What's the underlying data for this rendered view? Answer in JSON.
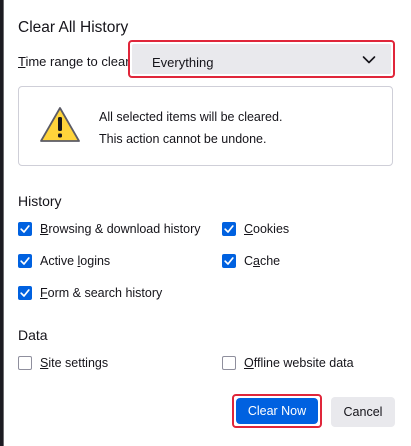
{
  "dialog": {
    "title": "Clear All History"
  },
  "time_range": {
    "label_prefix": "",
    "label_mnemonic": "T",
    "label_rest": "ime range to clear:",
    "selected": "Everything"
  },
  "warning": {
    "line1": "All selected items will be cleared.",
    "line2": "This action cannot be undone."
  },
  "history": {
    "title": "History",
    "browsing": {
      "m": "B",
      "rest": "rowsing & download history",
      "checked": true
    },
    "cookies": {
      "m": "C",
      "rest": "ookies",
      "checked": true
    },
    "logins": {
      "pre": "Active ",
      "m": "l",
      "rest": "ogins",
      "checked": true
    },
    "cache": {
      "pre": "C",
      "m": "a",
      "rest": "che",
      "checked": true
    },
    "forms": {
      "m": "F",
      "rest": "orm & search history",
      "checked": true
    }
  },
  "data": {
    "title": "Data",
    "site_settings": {
      "m": "S",
      "rest": "ite settings",
      "checked": false
    },
    "offline": {
      "m": "O",
      "rest": "ffline website data",
      "checked": false
    }
  },
  "buttons": {
    "clear_now": "Clear Now",
    "cancel": "Cancel"
  },
  "colors": {
    "accent": "#0061e0",
    "highlight": "#e0263a",
    "warning_yellow": "#ffd43b"
  },
  "icons": {
    "dropdown": "chevron-down-icon",
    "warning": "warning-triangle-icon",
    "check": "checkmark-icon"
  }
}
